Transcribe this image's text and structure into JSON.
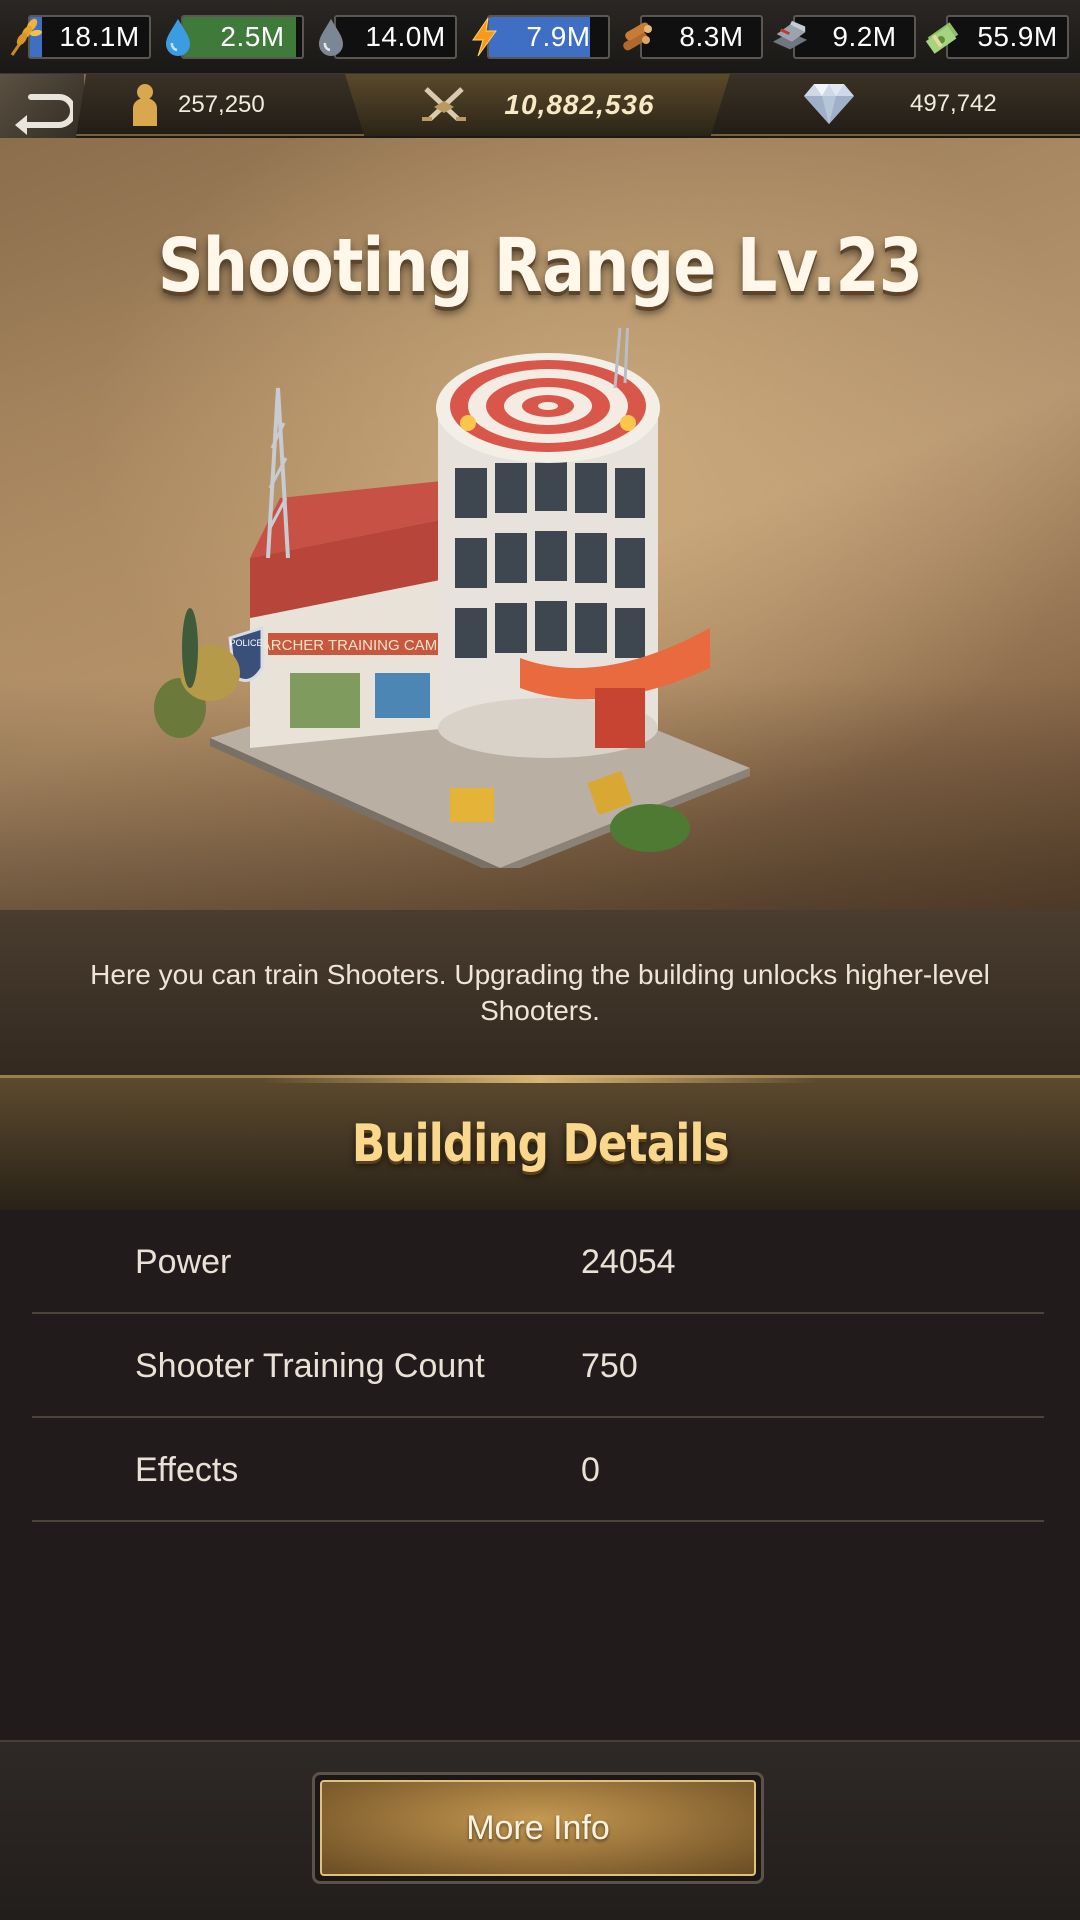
{
  "resources": [
    {
      "icon": "wheat-icon",
      "value": "18.1M",
      "fill": 0.1,
      "fill_color": "#3e6fc4"
    },
    {
      "icon": "water-drop-icon",
      "value": "2.5M",
      "fill": 0.95,
      "fill_color": "#3f7a3a"
    },
    {
      "icon": "oil-drop-icon",
      "value": "14.0M",
      "fill": 0,
      "fill_color": "#3e6fc4"
    },
    {
      "icon": "lightning-icon",
      "value": "7.9M",
      "fill": 0.85,
      "fill_color": "#3e6fc4"
    },
    {
      "icon": "wood-logs-icon",
      "value": "8.3M",
      "fill": 0,
      "fill_color": "#3e6fc4"
    },
    {
      "icon": "steel-ingot-icon",
      "value": "9.2M",
      "fill": 0,
      "fill_color": "#3e6fc4"
    },
    {
      "icon": "cash-icon",
      "value": "55.9M",
      "fill": 0,
      "fill_color": "#3e6fc4"
    }
  ],
  "header": {
    "population": "257,250",
    "power": "10,882,536",
    "gems": "497,742"
  },
  "building": {
    "title": "Shooting Range Lv.23",
    "sign_text": "ARCHER TRAINING CAMP",
    "badge_text": "POLICE",
    "description": "Here you can train Shooters. Upgrading the building unlocks higher-level Shooters."
  },
  "details": {
    "heading": "Building Details",
    "rows": [
      {
        "label": "Power",
        "value": "24054"
      },
      {
        "label": "Shooter Training Count",
        "value": "750"
      },
      {
        "label": "Effects",
        "value": "0"
      }
    ]
  },
  "footer": {
    "more_info_label": "More Info"
  }
}
